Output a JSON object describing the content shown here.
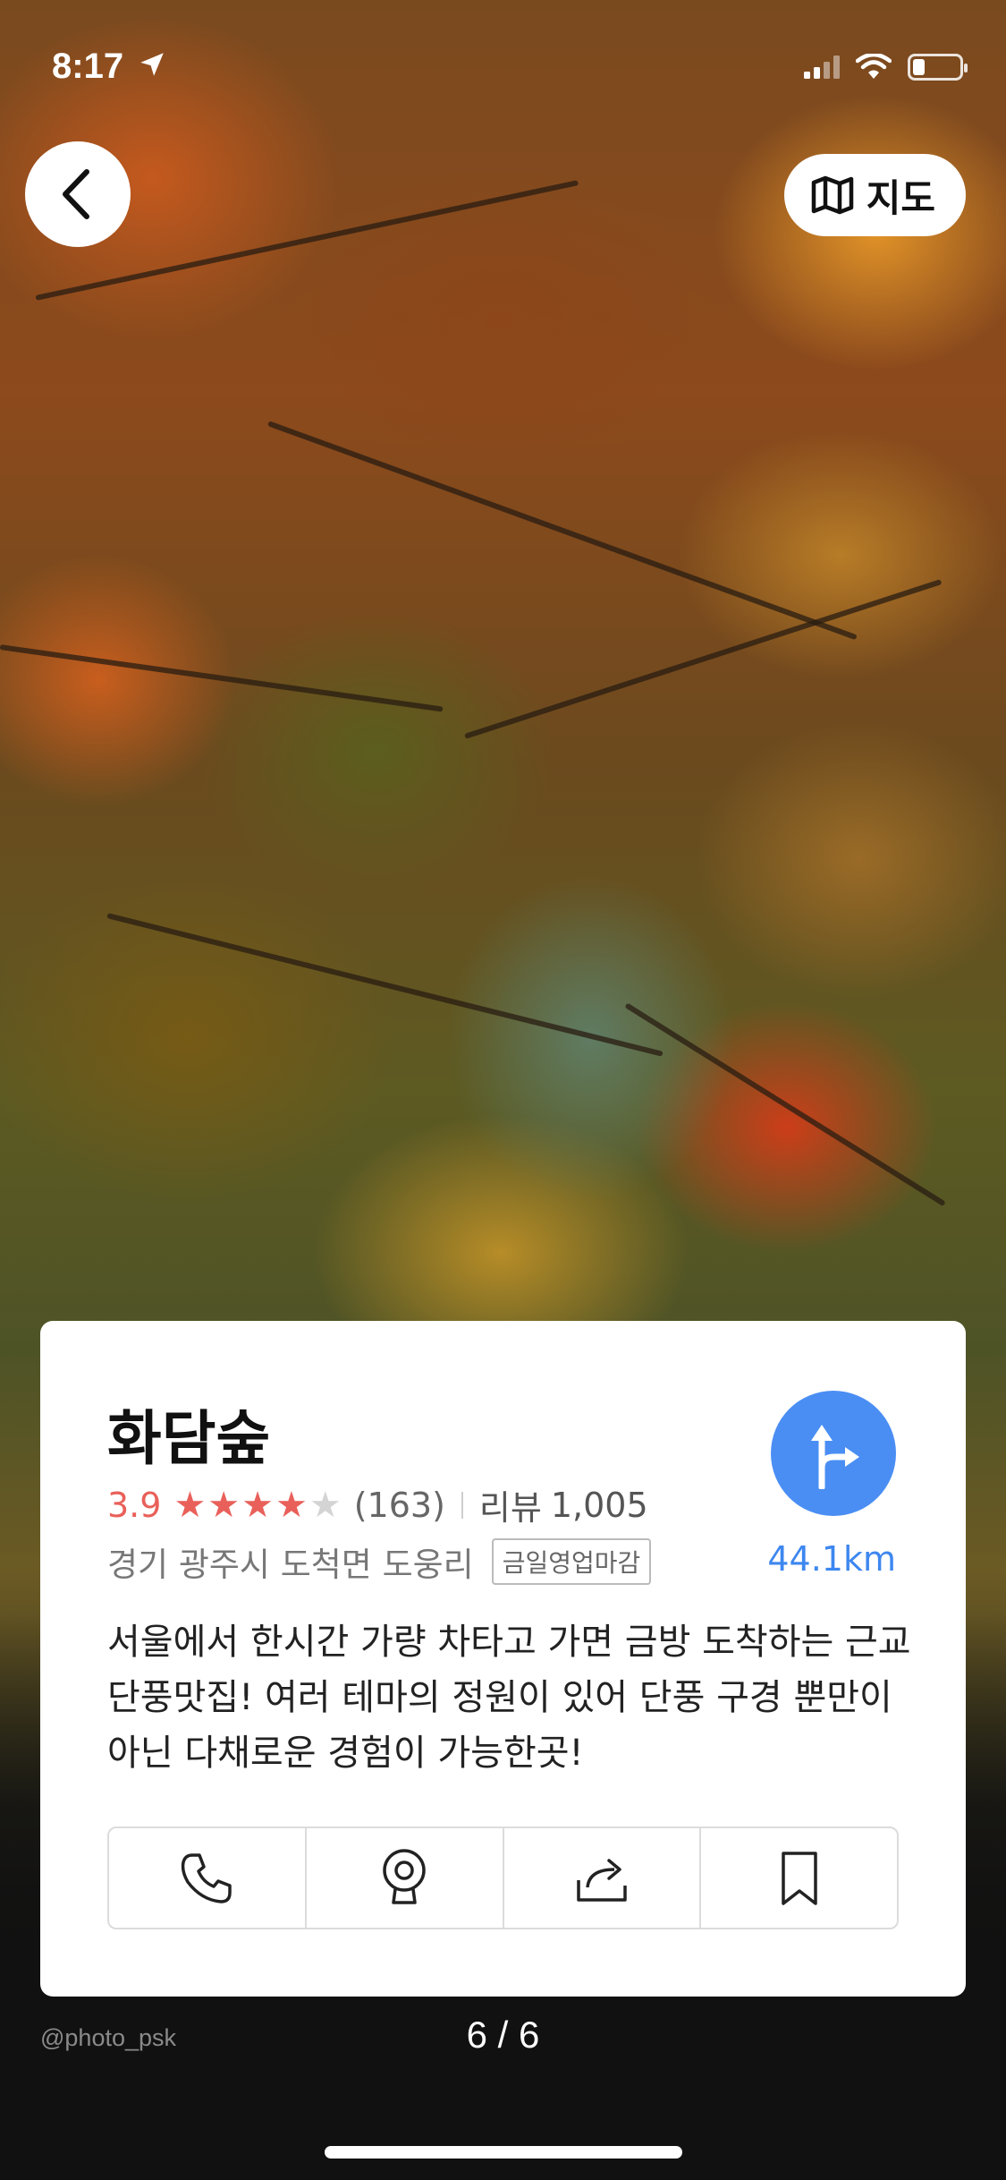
{
  "status_bar": {
    "time": "8:17",
    "battery_level": 0.2
  },
  "top_bar": {
    "back_icon": "chevron-left-icon",
    "map_button_label": "지도",
    "map_icon": "map-icon"
  },
  "place": {
    "name": "화담숲",
    "rating": "3.9",
    "stars_filled": 4,
    "stars_total": 5,
    "rating_count": "(163)",
    "review_label": "리뷰",
    "review_count": "1,005",
    "address": "경기 광주시 도척면 도웅리",
    "status_badge": "금일영업마감",
    "distance": "44.1km",
    "description": "서울에서 한시간 가량 차타고 가면 금방 도착하는 근교 단풍맛집! 여러 테마의 정원이 있어 단풍 구경 뿐만이 아닌 다채로운 경험이 가능한곳!"
  },
  "actions": [
    {
      "icon": "phone-icon"
    },
    {
      "icon": "street-view-icon"
    },
    {
      "icon": "share-icon"
    },
    {
      "icon": "bookmark-icon"
    }
  ],
  "footer": {
    "photo_credit": "@photo_psk",
    "page_indicator": "6 / 6"
  },
  "colors": {
    "accent_blue": "#4a8ef4",
    "rating_red": "#e9605a",
    "card_bg": "#ffffff"
  }
}
